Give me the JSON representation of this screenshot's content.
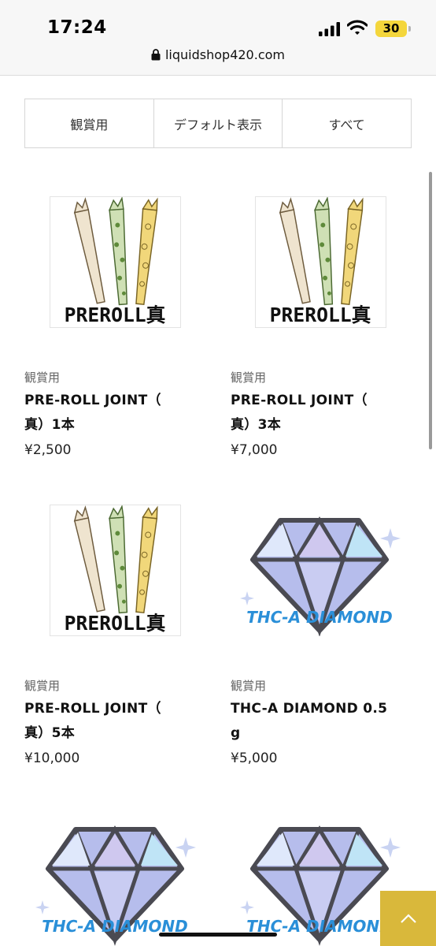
{
  "status": {
    "time": "17:24",
    "battery": "30"
  },
  "browser": {
    "url": "liquidshop420.com"
  },
  "sort_tabs": [
    "観賞用",
    "デフォルト表示",
    "すべて"
  ],
  "products": [
    {
      "category": "観賞用",
      "name_line1": "PRE-ROLL JOINT（",
      "name_line2": "真）1本",
      "price": "¥2,500",
      "image": "preroll-image",
      "image_text": "PREROLL真"
    },
    {
      "category": "観賞用",
      "name_line1": "PRE-ROLL JOINT（",
      "name_line2": "真）3本",
      "price": "¥7,000",
      "image": "preroll-image",
      "image_text": "PREROLL真"
    },
    {
      "category": "観賞用",
      "name_line1": "PRE-ROLL JOINT（",
      "name_line2": "真）5本",
      "price": "¥10,000",
      "image": "preroll-image",
      "image_text": "PREROLL真"
    },
    {
      "category": "観賞用",
      "name_line1": "THC-A DIAMOND 0.5",
      "name_line2": "g",
      "price": "¥5,000",
      "image": "diamond-image",
      "image_text": "THC-A DIAMOND"
    },
    {
      "image": "diamond-image",
      "image_text": "THC-A DIAMOND"
    },
    {
      "image": "diamond-image",
      "image_text": "THC-A DIAMOND"
    }
  ],
  "colors": {
    "accent": "#d9b83b",
    "battery": "#f4d63c",
    "diamond_fill": "#a9b2e6",
    "diamond_text": "#2a8fd8"
  },
  "icons": [
    "signal-icon",
    "wifi-icon",
    "lock-icon",
    "chevron-up-icon"
  ]
}
